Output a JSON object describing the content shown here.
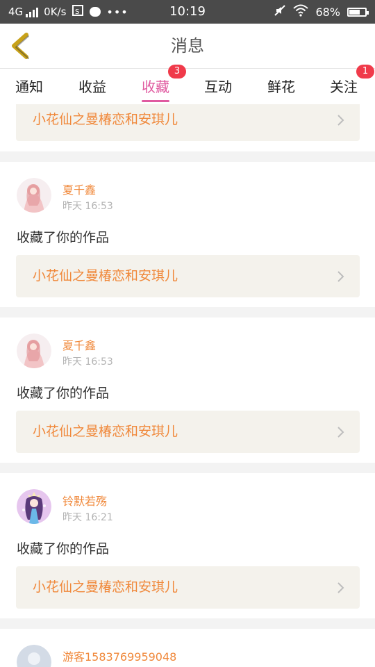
{
  "status_bar": {
    "network": "4G",
    "speed": "0K/s",
    "time": "10:19",
    "battery": "68%",
    "battery_level": 0.68,
    "icons": [
      "signal-icon",
      "screenshot-icon",
      "chat-icon",
      "more-icon",
      "mute-icon",
      "wifi-icon",
      "battery-icon"
    ]
  },
  "header": {
    "title": "消息",
    "back_icon": "chevron-left-icon"
  },
  "colors": {
    "accent": "#e05aa0",
    "name": "#f0883a",
    "badge": "#f03a4a",
    "back_icon": "#c8a21a"
  },
  "tabs": [
    {
      "label": "通知",
      "active": false,
      "badge": ""
    },
    {
      "label": "收益",
      "active": false,
      "badge": ""
    },
    {
      "label": "收藏",
      "active": true,
      "badge": "3"
    },
    {
      "label": "互动",
      "active": false,
      "badge": ""
    },
    {
      "label": "鲜花",
      "active": false,
      "badge": ""
    },
    {
      "label": "关注",
      "active": false,
      "badge": "1"
    }
  ],
  "feed": {
    "partial_top": {
      "work_title": "小花仙之曼椿恋和安琪儿"
    },
    "items": [
      {
        "name": "夏千鑫",
        "time": "昨天 16:53",
        "message": "收藏了你的作品",
        "work_title": "小花仙之曼椿恋和安琪儿"
      },
      {
        "name": "夏千鑫",
        "time": "昨天 16:53",
        "message": "收藏了你的作品",
        "work_title": "小花仙之曼椿恋和安琪儿"
      },
      {
        "name": "铃默若殇",
        "time": "昨天 16:21",
        "message": "收藏了你的作品",
        "work_title": "小花仙之曼椿恋和安琪儿"
      }
    ],
    "partial_bottom": {
      "name": "游客1583769959048"
    }
  }
}
